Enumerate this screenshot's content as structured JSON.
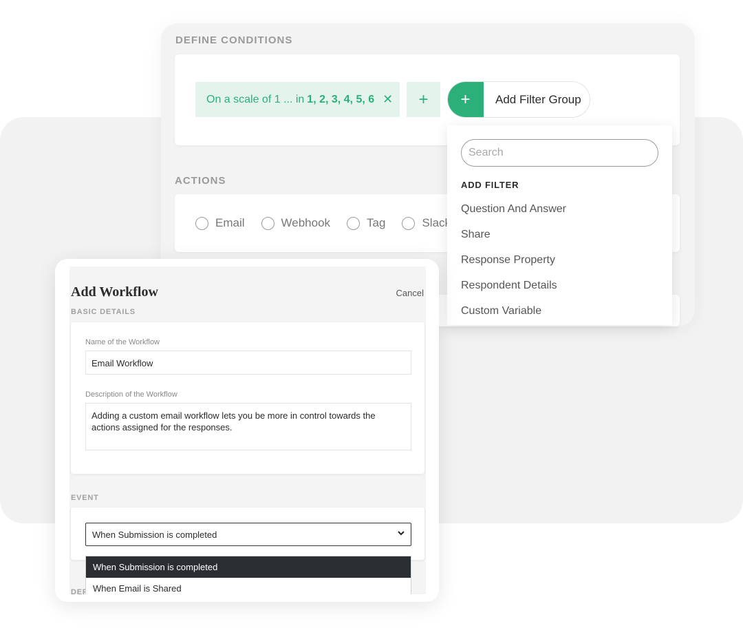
{
  "conditions": {
    "section_label": "DEFINE CONDITIONS",
    "chip": {
      "prefix": "On a scale of 1 ... in",
      "values": "1, 2, 3, 4, 5, 6",
      "remove_glyph": "✕"
    },
    "add_condition_glyph": "+",
    "add_filter_group": {
      "glyph": "+",
      "label": "Add Filter Group"
    },
    "accent_color": "#2bb07a"
  },
  "actions": {
    "section_label": "ACTIONS",
    "options": [
      "Email",
      "Webhook",
      "Tag",
      "Slack"
    ]
  },
  "filter_dropdown": {
    "search_placeholder": "Search",
    "heading": "ADD FILTER",
    "items": [
      "Question And Answer",
      "Share",
      "Response Property",
      "Respondent Details",
      "Custom Variable"
    ]
  },
  "workflow": {
    "title": "Add Workflow",
    "cancel_label": "Cancel",
    "basic_details_label": "BASIC DETAILS",
    "name_label": "Name of the Workflow",
    "name_value": "Email Workflow",
    "description_label": "Description of the Workflow",
    "description_value": "Adding a custom email workflow lets you be more in control towards the actions assigned for the responses.",
    "event_label": "EVENT",
    "event_selected": "When Submission is completed",
    "event_options": [
      "When Submission is completed",
      "When Email is Shared"
    ],
    "next_section_label": "DEF"
  }
}
